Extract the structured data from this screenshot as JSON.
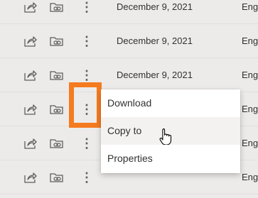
{
  "rows": [
    {
      "date": "December 9, 2021",
      "owner": "Engele"
    },
    {
      "date": "December 9, 2021",
      "owner": "Engele"
    },
    {
      "date": "December 9, 2021",
      "owner": "Engele"
    },
    {
      "date": "",
      "owner": "Engele"
    },
    {
      "date": "",
      "owner": "Engele"
    },
    {
      "date": "",
      "owner": "Engele"
    }
  ],
  "icons": {
    "share": "share-icon",
    "shortcut": "add-shortcut-icon",
    "more": "more-options-icon"
  },
  "menu": {
    "items": [
      {
        "label": "Download"
      },
      {
        "label": "Copy to"
      },
      {
        "label": "Properties"
      }
    ]
  },
  "colors": {
    "highlight": "#f47b20",
    "row_bg": "#edebe9",
    "menu_bg": "#ffffff",
    "menu_hover": "#f3f2f1"
  }
}
